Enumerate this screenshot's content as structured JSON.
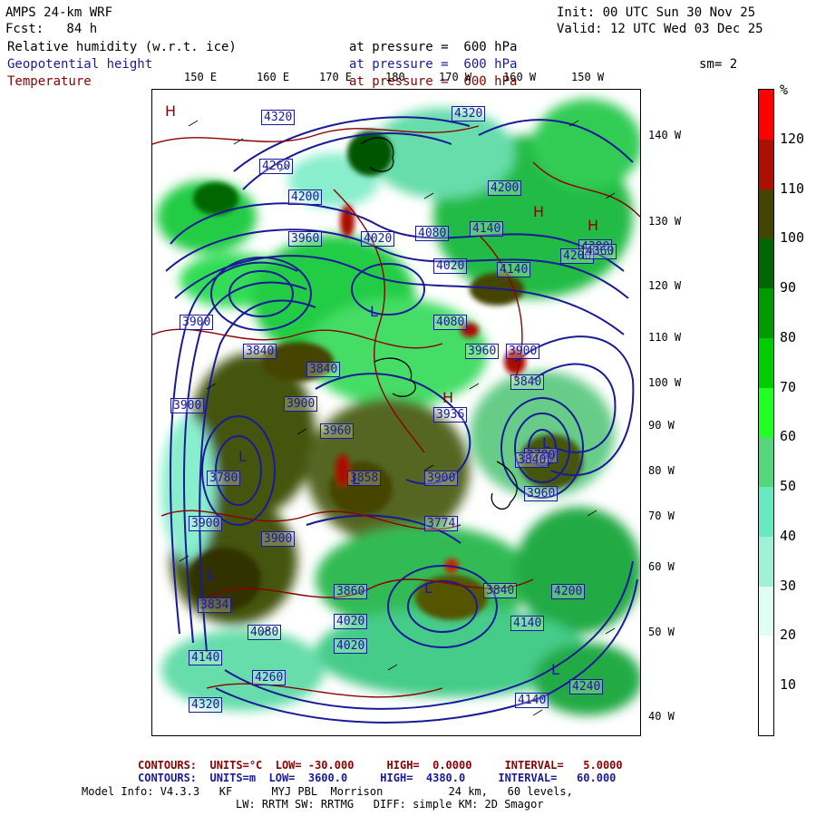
{
  "header": {
    "model": "AMPS 24-km WRF",
    "fcst": "Fcst:   84 h",
    "init": "Init: 00 UTC Sun 30 Nov 25",
    "valid": "Valid: 12 UTC Wed 03 Dec 25",
    "field1": "Relative humidity (w.r.t. ice)",
    "field1_level": "at pressure =  600 hPa",
    "field2": "Geopotential height",
    "field2_level": "at pressure =  600 hPa",
    "field3": "Temperature",
    "field3_level": "at pressure =  600 hPa",
    "smoothing": "sm= 2"
  },
  "colors": {
    "rh_scale": [
      "#ffffff",
      "#ffffff",
      "#e0fff4",
      "#9ff0d6",
      "#66e8c0",
      "#55d57c",
      "#22ff22",
      "#00cc00",
      "#009900",
      "#006600",
      "#444400",
      "#aa1100",
      "#ff0000"
    ],
    "height_contour": "#1a1a99",
    "temp_contour": "#8b0000"
  },
  "colorbar": {
    "unit": "%",
    "ticks": [
      "120",
      "110",
      "100",
      "90",
      "80",
      "70",
      "60",
      "50",
      "40",
      "30",
      "20",
      "10"
    ]
  },
  "lon_labels": [
    "150 E",
    "160 E",
    "170 E",
    "180",
    "170 W",
    "160 W",
    "150 W"
  ],
  "lat_labels": [
    "140 W",
    "130 W",
    "120 W",
    "110 W",
    "100 W",
    "90 W",
    "80 W",
    "70 W",
    "60 W",
    "50 W",
    "40 W"
  ],
  "height_labels": [
    "4320",
    "4260",
    "4200",
    "4320",
    "4020",
    "4080",
    "4140",
    "4200",
    "4380",
    "4020",
    "3960",
    "3900",
    "3840",
    "3840",
    "3900",
    "3900",
    "3780",
    "3960",
    "3936",
    "3780",
    "3840",
    "3960",
    "3858",
    "3900",
    "3900",
    "3774",
    "3840",
    "3860",
    "3834",
    "4020",
    "4080",
    "4140",
    "4020",
    "4140",
    "4200",
    "4260",
    "4320",
    "4140",
    "4200",
    "4240",
    "4360",
    "4140",
    "4080",
    "3960",
    "3900",
    "3840",
    "3900"
  ],
  "map_marks": [
    "H",
    "H",
    "H",
    "H",
    "L",
    "L",
    "L",
    "L",
    "L",
    "L",
    "L"
  ],
  "footer": {
    "temp_line": "CONTOURS:  UNITS=°C  LOW= -30.000     HIGH=  0.0000     INTERVAL=   5.0000",
    "height_line": "CONTOURS:  UNITS=m  LOW=  3600.0     HIGH=  4380.0     INTERVAL=   60.000",
    "model_info": "Model Info: V4.3.3   KF      MYJ PBL  Morrison          24 km,   60 levels,",
    "model_info2": "LW: RRTM SW: RRTMG   DIFF: simple KM: 2D Smagor"
  }
}
